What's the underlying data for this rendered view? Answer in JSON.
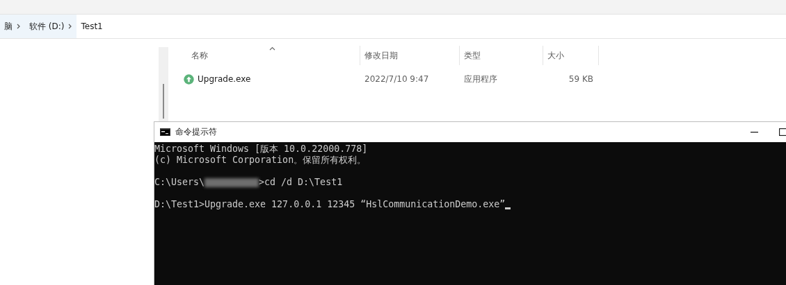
{
  "breadcrumb": [
    {
      "label": "脑",
      "highlighted": true
    },
    {
      "label": "软件 (D:)",
      "highlighted": true
    },
    {
      "label": "Test1",
      "highlighted": false
    }
  ],
  "file_list": {
    "columns": [
      {
        "label": "名称",
        "sorted": true
      },
      {
        "label": "修改日期",
        "sorted": false
      },
      {
        "label": "类型",
        "sorted": false
      },
      {
        "label": "大小",
        "sorted": false
      }
    ],
    "rows": [
      {
        "name": "Upgrade.exe",
        "date": "2022/7/10 9:47",
        "type": "应用程序",
        "size": "59 KB"
      }
    ]
  },
  "console_window": {
    "title": "命令提示符",
    "lines": [
      {
        "kind": "output",
        "text": "Microsoft Windows [版本 10.0.22000.778]"
      },
      {
        "kind": "output",
        "text": "(c) Microsoft Corporation。保留所有权利。"
      },
      {
        "kind": "prompt",
        "text": "C:\\Users\\",
        "redacted": true,
        "after": ">cd /d D:\\Test1",
        "cursor": false
      },
      {
        "kind": "prompt",
        "text": "D:\\Test1>Upgrade.exe 127.0.0.1 12345 “HslCommunicationDemo.exe”",
        "redacted": false,
        "cursor": true
      }
    ]
  }
}
